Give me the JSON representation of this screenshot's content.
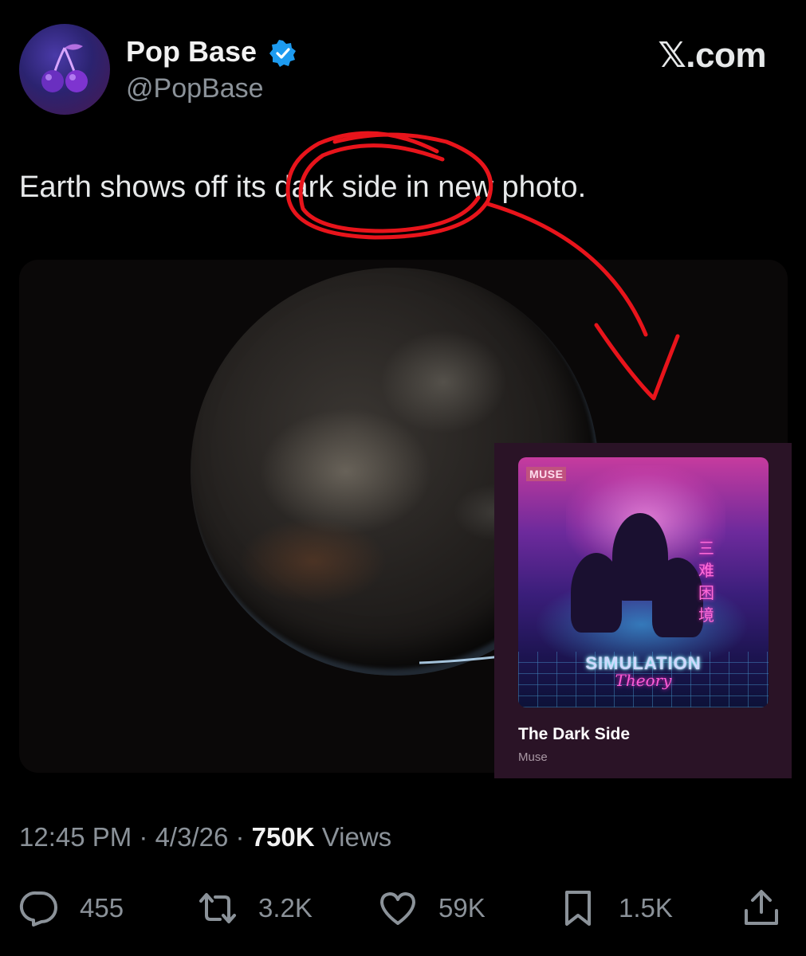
{
  "header": {
    "display_name": "Pop Base",
    "handle": "@PopBase",
    "site_label": "𝕏.com",
    "verified_icon": "verified-badge-icon",
    "avatar_icon": "cherries-icon"
  },
  "tweet": {
    "text": "Earth shows off its dark side in new photo.",
    "media_description_icon": "earth-photo"
  },
  "album_card": {
    "art_label": "MUSE",
    "art_title": "SIMULATION",
    "art_subtitle": "Theory",
    "art_side_text": "三\n难\n困\n境",
    "track_title": "The Dark Side",
    "track_artist": "Muse"
  },
  "meta": {
    "time": "12:45 PM",
    "separator": " · ",
    "date": "4/3/26",
    "views_count": "750K",
    "views_label": "Views"
  },
  "actions": {
    "replies": "455",
    "reposts": "3.2K",
    "likes": "59K",
    "bookmarks": "1.5K"
  },
  "colors": {
    "background": "#000000",
    "text_primary": "#e7e9ea",
    "text_secondary": "#8b9299",
    "verified_blue": "#1d9bf0",
    "annotation_red": "#e8141b",
    "card_background": "#2a1326"
  }
}
